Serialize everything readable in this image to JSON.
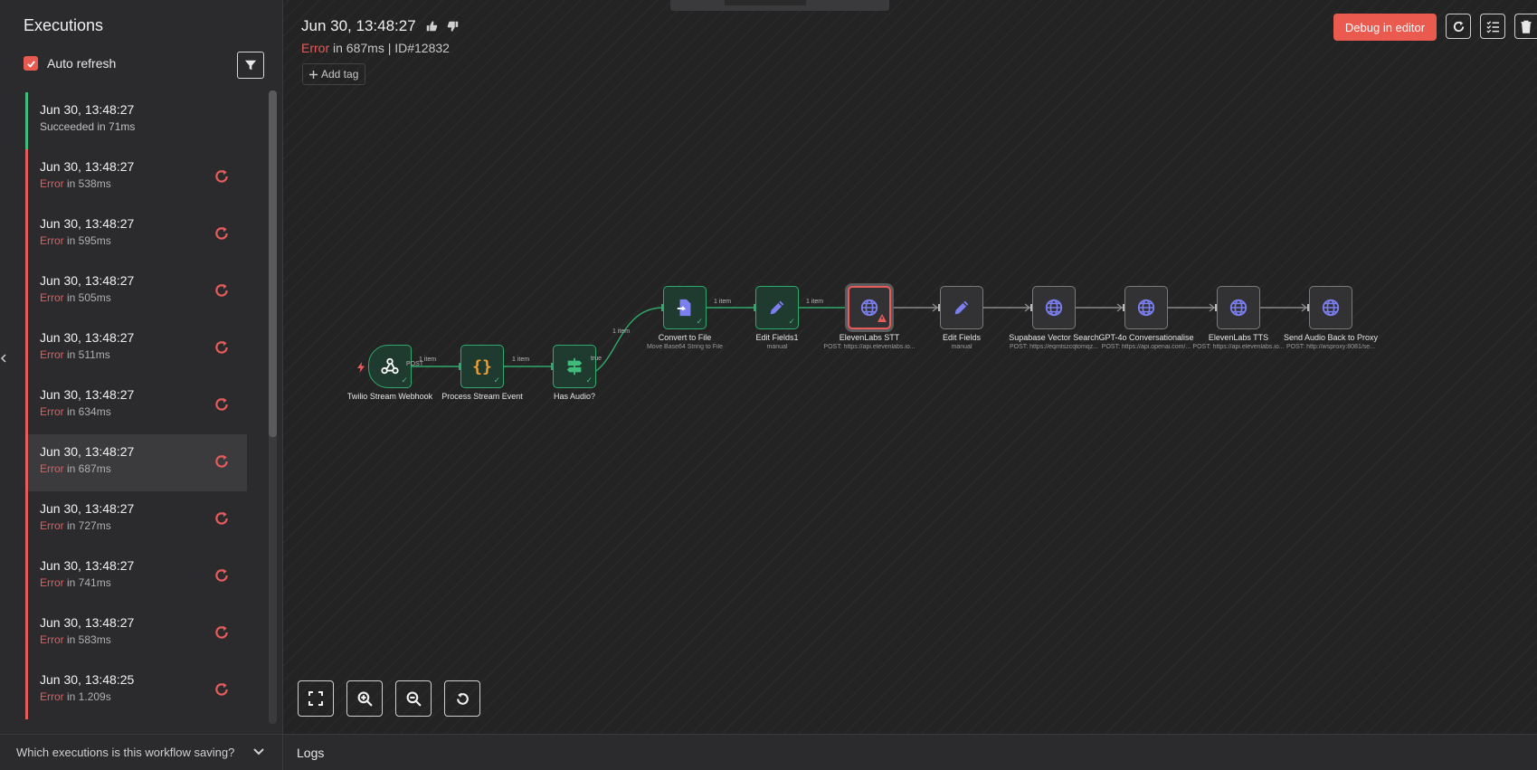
{
  "sidebar": {
    "title": "Executions",
    "auto_refresh_label": "Auto refresh",
    "auto_refresh_checked": true,
    "executions": [
      {
        "time": "Jun 30, 13:48:27",
        "status": "success",
        "status_prefix": "Succeeded in 71ms",
        "status_value": ""
      },
      {
        "time": "Jun 30, 13:48:27",
        "status": "error",
        "status_prefix": "Error",
        "status_value": " in 538ms"
      },
      {
        "time": "Jun 30, 13:48:27",
        "status": "error",
        "status_prefix": "Error",
        "status_value": " in 595ms"
      },
      {
        "time": "Jun 30, 13:48:27",
        "status": "error",
        "status_prefix": "Error",
        "status_value": " in 505ms"
      },
      {
        "time": "Jun 30, 13:48:27",
        "status": "error",
        "status_prefix": "Error",
        "status_value": " in 511ms"
      },
      {
        "time": "Jun 30, 13:48:27",
        "status": "error",
        "status_prefix": "Error",
        "status_value": " in 634ms"
      },
      {
        "time": "Jun 30, 13:48:27",
        "status": "error",
        "status_prefix": "Error",
        "status_value": " in 687ms",
        "selected": true
      },
      {
        "time": "Jun 30, 13:48:27",
        "status": "error",
        "status_prefix": "Error",
        "status_value": " in 727ms"
      },
      {
        "time": "Jun 30, 13:48:27",
        "status": "error",
        "status_prefix": "Error",
        "status_value": " in 741ms"
      },
      {
        "time": "Jun 30, 13:48:27",
        "status": "error",
        "status_prefix": "Error",
        "status_value": " in 583ms"
      },
      {
        "time": "Jun 30, 13:48:25",
        "status": "error",
        "status_prefix": "Error",
        "status_value": " in 1.209s"
      }
    ],
    "footer_question": "Which executions is this workflow saving?"
  },
  "header": {
    "title": "Jun 30, 13:48:27",
    "status_error": "Error",
    "status_rest": " in 687ms | ID#12832",
    "add_tag_label": "Add tag",
    "debug_button": "Debug in editor"
  },
  "workflow": {
    "nodes": [
      {
        "label": "Twilio Stream Webhook",
        "sub": "",
        "icon": "webhook-icon",
        "state": "done"
      },
      {
        "label": "Process Stream Event",
        "sub": "",
        "icon": "code-braces-icon",
        "state": "done"
      },
      {
        "label": "Has Audio?",
        "sub": "",
        "icon": "signpost-icon",
        "state": "done"
      },
      {
        "label": "Convert to File",
        "sub": "Move Base64 String to File",
        "icon": "file-convert-icon",
        "state": "done"
      },
      {
        "label": "Edit Fields1",
        "sub": "manual",
        "icon": "pencil-icon",
        "state": "done"
      },
      {
        "label": "ElevenLabs STT",
        "sub": "POST: https://api.elevenlabs.io...",
        "icon": "globe-icon",
        "state": "error"
      },
      {
        "label": "Edit Fields",
        "sub": "manual",
        "icon": "pencil-icon",
        "state": "pending"
      },
      {
        "label": "Supabase Vector Search",
        "sub": "POST: https://eqmtszcqtomqz...",
        "icon": "globe-icon",
        "state": "pending"
      },
      {
        "label": "GPT-4o Conversationalise",
        "sub": "POST: https://api.openai.com/...",
        "icon": "globe-icon",
        "state": "pending"
      },
      {
        "label": "ElevenLabs TTS",
        "sub": "POST: https://api.elevenlabs.io...",
        "icon": "globe-icon",
        "state": "pending"
      },
      {
        "label": "Send Audio Back to Proxy",
        "sub": "POST: http://wsproxy:8081/se...",
        "icon": "globe-icon",
        "state": "pending"
      }
    ],
    "connection_labels": {
      "post": "POST",
      "item": "1 item",
      "true": "true"
    }
  },
  "logs_label": "Logs",
  "colors": {
    "accent": "#ea5a4f",
    "error": "#e85b5b",
    "success": "#3fbb7a",
    "node_icon_blue": "#7b7ff0",
    "node_icon_orange": "#f0a030"
  }
}
